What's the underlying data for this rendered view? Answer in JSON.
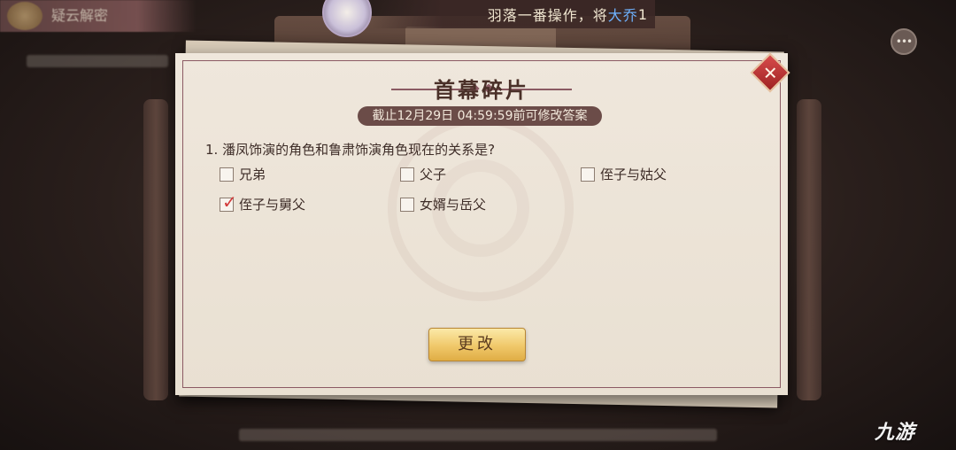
{
  "background": {
    "banner_label": "疑云解密",
    "ticker": {
      "prefix": "羽落一番操作，将",
      "highlight": "大乔",
      "suffix": "1"
    },
    "chat_icon": "chat-bubble-icon",
    "logo": "九游"
  },
  "dialog": {
    "title": "首幕碎片",
    "deadline": "截止12月29日 04:59:59前可修改答案",
    "question": "1. 潘凤饰演的角色和鲁肃饰演角色现在的关系是?",
    "options": [
      {
        "label": "兄弟",
        "checked": false
      },
      {
        "label": "父子",
        "checked": false
      },
      {
        "label": "侄子与姑父",
        "checked": false
      },
      {
        "label": "侄子与舅父",
        "checked": true
      },
      {
        "label": "女婿与岳父",
        "checked": false
      }
    ],
    "checkmark": "✓",
    "close_icon": "✕",
    "change_button": "更改"
  },
  "colors": {
    "accent": "#8b5a63",
    "check": "#d33a3a",
    "button": "#f0c86a",
    "ticker_highlight": "#6fb3ff"
  }
}
